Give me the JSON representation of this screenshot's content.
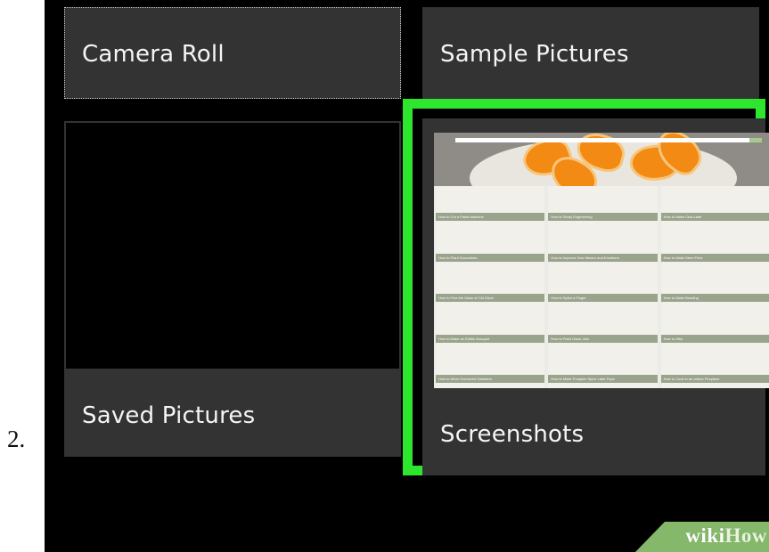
{
  "step": {
    "number": "2."
  },
  "folders": {
    "camera_roll": "Camera Roll",
    "sample_pictures": "Sample Pictures",
    "saved_pictures": "Saved Pictures",
    "screenshots": "Screenshots"
  },
  "thumbnail_articles": [
    "How to Cut a Pasta Machine",
    "How to Study Engineering",
    "How to Make Chai Latte",
    "How to Plant Succulents",
    "How to Improve Your Mentor and Emotions",
    "How to Make Stem Fries",
    "How to Find the Value of Old Discs",
    "How to Splint a Finger",
    "How to Make Beading",
    "How to Make an Edible Bouquet",
    "How to Paint Glass Jars",
    "How to Hike",
    "How to Wear Oversized Sweaters",
    "How to Make Pumpkin Spice Latte Pops",
    "How to Cook in an Indoor Fireplace"
  ],
  "watermark": {
    "prefix": "wiki",
    "suffix": "How"
  },
  "colors": {
    "highlight": "#2ee62e",
    "tile_background": "#333333",
    "window_background": "#000000",
    "watermark_green": "#85b86a"
  }
}
